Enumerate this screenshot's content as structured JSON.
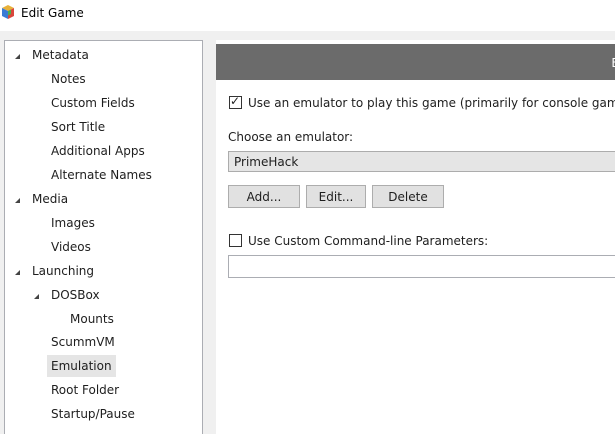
{
  "window": {
    "title": "Edit Game"
  },
  "tree": {
    "items": [
      {
        "label": "Metadata",
        "expanded": true
      },
      {
        "label": "Notes"
      },
      {
        "label": "Custom Fields"
      },
      {
        "label": "Sort Title"
      },
      {
        "label": "Additional Apps"
      },
      {
        "label": "Alternate Names"
      },
      {
        "label": "Media",
        "expanded": true
      },
      {
        "label": "Images"
      },
      {
        "label": "Videos"
      },
      {
        "label": "Launching",
        "expanded": true
      },
      {
        "label": "DOSBox",
        "expanded": true
      },
      {
        "label": "Mounts"
      },
      {
        "label": "ScummVM"
      },
      {
        "label": "Emulation",
        "selected": true
      },
      {
        "label": "Root Folder"
      },
      {
        "label": "Startup/Pause"
      }
    ]
  },
  "header": {
    "text": "E"
  },
  "emulation": {
    "use_emulator_label": "Use an emulator to play this game (primarily for console games)",
    "use_emulator_checked": true,
    "choose_label": "Choose an emulator:",
    "selected_emulator": "PrimeHack",
    "add_label": "Add...",
    "edit_label": "Edit...",
    "delete_label": "Delete",
    "custom_params_label": "Use Custom Command-line Parameters:",
    "custom_params_checked": false,
    "custom_params_value": ""
  },
  "colors": {
    "header_band": "#6b6b6b",
    "selected_item": "#e5e5e5",
    "button_face": "#e1e1e1"
  }
}
